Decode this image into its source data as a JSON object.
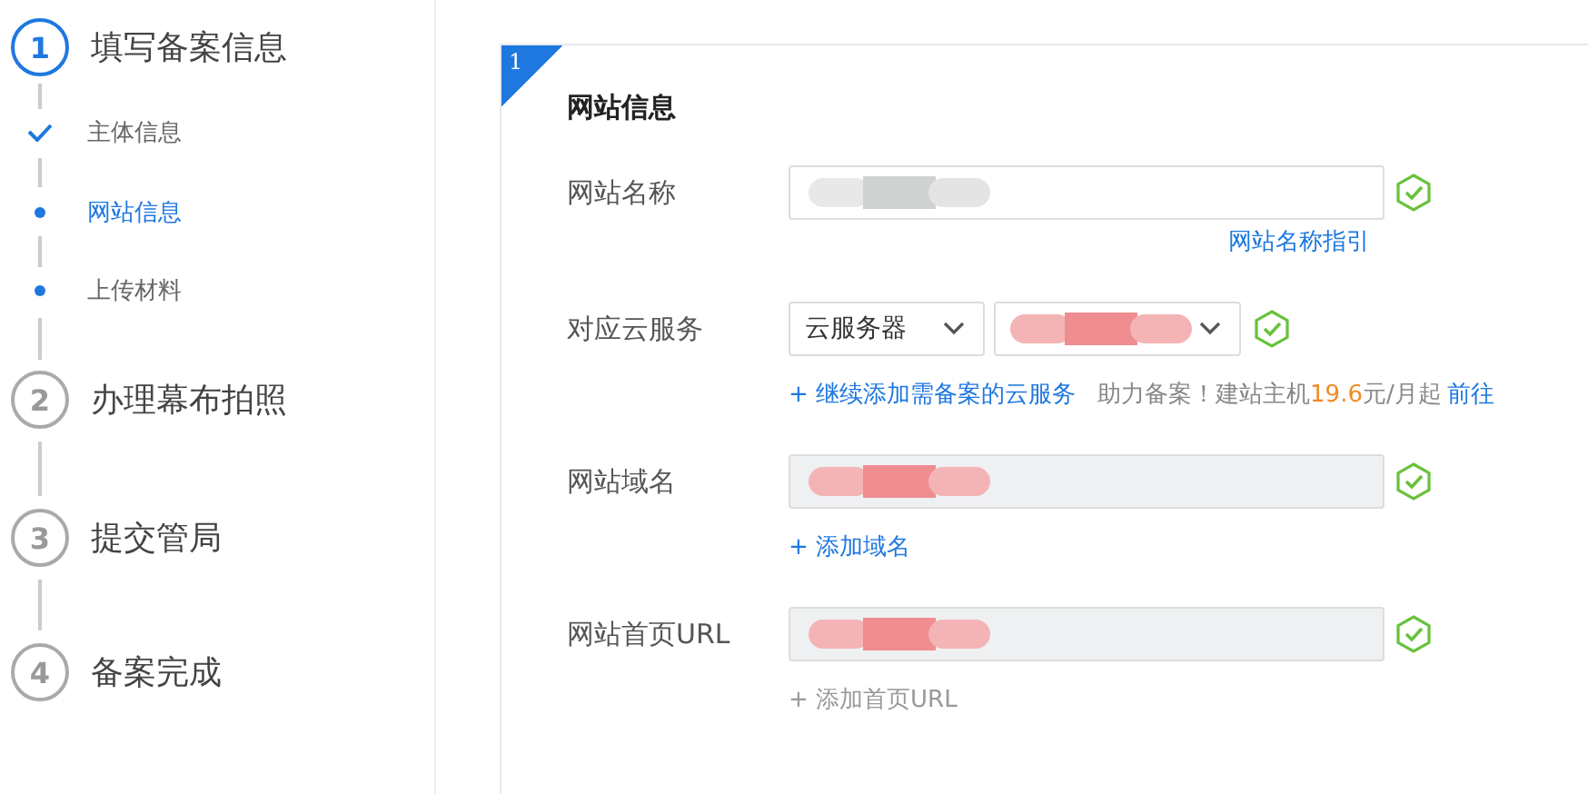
{
  "steps": [
    {
      "number": "1",
      "label": "填写备案信息",
      "active": true,
      "substeps": [
        {
          "label": "主体信息",
          "done": true,
          "selected": false
        },
        {
          "label": "网站信息",
          "done": false,
          "selected": true
        },
        {
          "label": "上传材料",
          "done": false,
          "selected": false
        }
      ]
    },
    {
      "number": "2",
      "label": "办理幕布拍照",
      "active": false
    },
    {
      "number": "3",
      "label": "提交管局",
      "active": false
    },
    {
      "number": "4",
      "label": "备案完成",
      "active": false
    }
  ],
  "form": {
    "section_number": "1",
    "title": "网站信息",
    "fields": [
      {
        "kind": "text",
        "label": "网站名称",
        "disabled": false,
        "redacted": true,
        "valid": true,
        "guide_link": "网站名称指引"
      },
      {
        "kind": "select-pair",
        "label": "对应云服务",
        "select_value": "云服务器",
        "redacted": true,
        "valid": true,
        "add_link": {
          "text": "+ 继续添加需备案的云服务",
          "disabled": false
        },
        "promo": {
          "text": "助力备案！建站主机",
          "price": "19.6",
          "unit": "元/月起",
          "link": "前往"
        }
      },
      {
        "kind": "text",
        "label": "网站域名",
        "disabled": true,
        "redacted": true,
        "valid": true,
        "add_link": {
          "text": "+ 添加域名",
          "disabled": false
        }
      },
      {
        "kind": "text",
        "label": "网站首页URL",
        "disabled": true,
        "redacted": true,
        "valid": true,
        "add_link": {
          "text": "+ 添加首页URL",
          "disabled": true
        }
      }
    ]
  }
}
